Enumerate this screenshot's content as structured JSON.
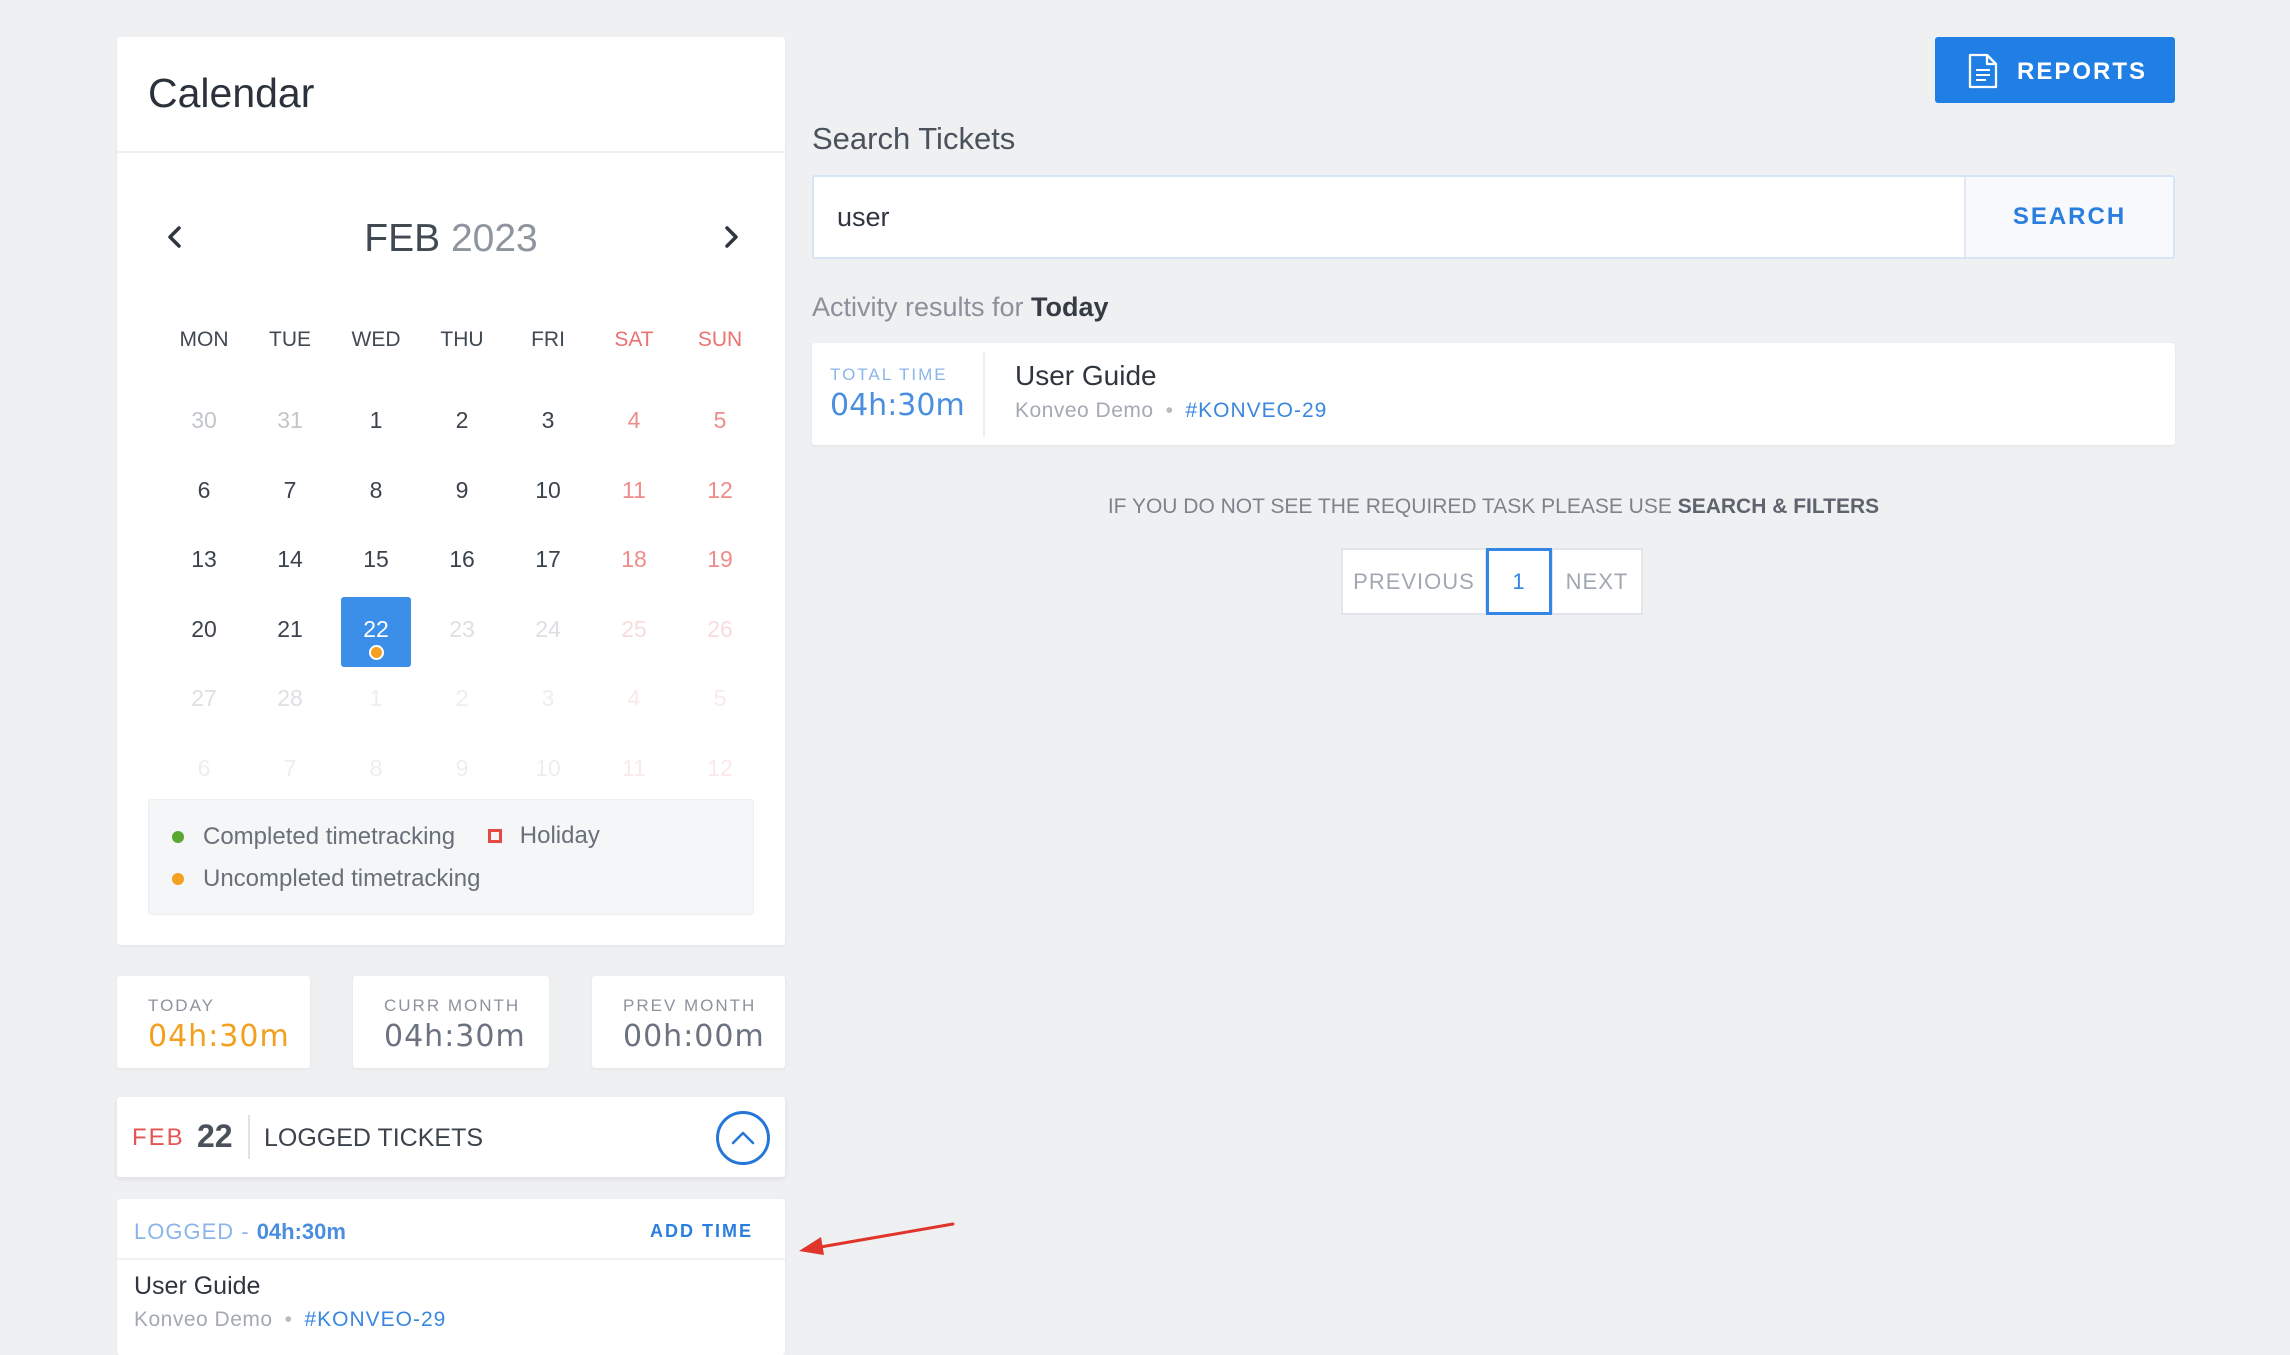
{
  "calendar": {
    "title": "Calendar",
    "month": "FEB",
    "year": "2023",
    "weekdays": [
      "MON",
      "TUE",
      "WED",
      "THU",
      "FRI",
      "SAT",
      "SUN"
    ],
    "days": [
      {
        "label": "30",
        "state": "muted"
      },
      {
        "label": "31",
        "state": "muted"
      },
      {
        "label": "1"
      },
      {
        "label": "2"
      },
      {
        "label": "3"
      },
      {
        "label": "4",
        "weekend": true
      },
      {
        "label": "5",
        "weekend": true
      },
      {
        "label": "6"
      },
      {
        "label": "7"
      },
      {
        "label": "8"
      },
      {
        "label": "9"
      },
      {
        "label": "10"
      },
      {
        "label": "11",
        "weekend": true
      },
      {
        "label": "12",
        "weekend": true
      },
      {
        "label": "13"
      },
      {
        "label": "14"
      },
      {
        "label": "15"
      },
      {
        "label": "16"
      },
      {
        "label": "17"
      },
      {
        "label": "18",
        "weekend": true
      },
      {
        "label": "19",
        "weekend": true
      },
      {
        "label": "20"
      },
      {
        "label": "21"
      },
      {
        "label": "22",
        "state": "selected",
        "dot": true
      },
      {
        "label": "23",
        "state": "future"
      },
      {
        "label": "24",
        "state": "future"
      },
      {
        "label": "25",
        "state": "future",
        "weekend": true
      },
      {
        "label": "26",
        "state": "future",
        "weekend": true
      },
      {
        "label": "27",
        "state": "future"
      },
      {
        "label": "28",
        "state": "future"
      },
      {
        "label": "1",
        "state": "out2"
      },
      {
        "label": "2",
        "state": "out2"
      },
      {
        "label": "3",
        "state": "out2"
      },
      {
        "label": "4",
        "state": "out2",
        "weekend": true
      },
      {
        "label": "5",
        "state": "out2",
        "weekend": true
      },
      {
        "label": "6",
        "state": "out2"
      },
      {
        "label": "7",
        "state": "out2"
      },
      {
        "label": "8",
        "state": "out2"
      },
      {
        "label": "9",
        "state": "out2"
      },
      {
        "label": "10",
        "state": "out2"
      },
      {
        "label": "11",
        "state": "out2",
        "weekend": true
      },
      {
        "label": "12",
        "state": "out2",
        "weekend": true
      }
    ],
    "legend": {
      "completed": "Completed timetracking",
      "holiday": "Holiday",
      "uncompleted": "Uncompleted timetracking",
      "completed_color": "#5aa832",
      "holiday_color": "#e64a48",
      "uncompleted_color": "#f4a020"
    }
  },
  "stats": {
    "today": {
      "label": "TODAY",
      "value": "04h:30m"
    },
    "curr_month": {
      "label": "CURR MONTH",
      "value": "04h:30m"
    },
    "prev_month": {
      "label": "PREV MONTH",
      "value": "00h:00m"
    }
  },
  "logged": {
    "month": "FEB",
    "day": "22",
    "title": "LOGGED TICKETS",
    "logged_label": "LOGGED - ",
    "logged_value": "04h:30m",
    "add_time": "ADD TIME",
    "ticket": {
      "title": "User Guide",
      "project": "Konveo Demo",
      "key": "#KONVEO-29"
    }
  },
  "toolbar": {
    "reports_label": "REPORTS"
  },
  "search": {
    "title": "Search Tickets",
    "value": "user",
    "button": "SEARCH",
    "activity_prefix": "Activity results for ",
    "activity_period": "Today"
  },
  "result": {
    "total_time_label": "TOTAL TIME",
    "total_time": "04h:30m",
    "title": "User Guide",
    "project": "Konveo Demo",
    "key": "#KONVEO-29"
  },
  "hint": {
    "text": "IF YOU DO NOT SEE THE REQUIRED TASK PLEASE USE ",
    "emph": "SEARCH & FILTERS"
  },
  "pager": {
    "prev": "PREVIOUS",
    "current": "1",
    "next": "NEXT"
  },
  "colors": {
    "accent": "#1f7fe5",
    "weekend": "#ec7170",
    "today_value": "#f2a01e",
    "annotation_arrow": "#e0352b"
  }
}
